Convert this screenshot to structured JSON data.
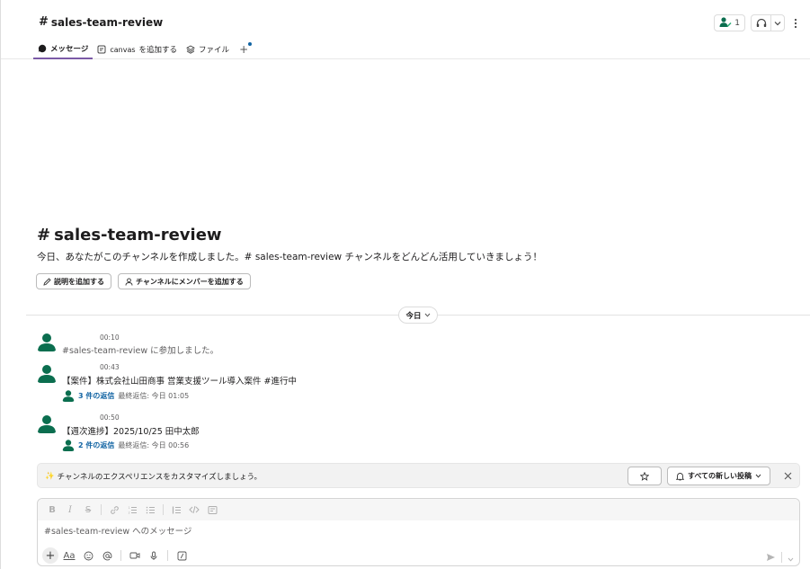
{
  "header": {
    "hash": "#",
    "channel_name": "sales-team-review",
    "member_count": "1",
    "tabs": [
      {
        "label": "メッセージ"
      },
      {
        "label": "を追加する",
        "prefix": "canvas"
      },
      {
        "label": "ファイル"
      }
    ],
    "add_tab_symbol": "+"
  },
  "intro": {
    "hash": "#",
    "title": "sales-team-review",
    "text": "今日、あなたがこのチャンネルを作成しました。# sales-team-review チャンネルをどんどん活用していきましょう！",
    "add_description_label": "説明を追加する",
    "add_member_label": "チャンネルにメンバーを追加する"
  },
  "divider": {
    "label": "今日"
  },
  "messages": [
    {
      "time": "00:10",
      "text": "#sales-team-review に参加しました。"
    },
    {
      "time": "00:43",
      "text": "【案件】株式会社山田商事 営業支援ツール導入案件 #進行中",
      "reply_count": "3 件の返信",
      "last_reply": "最終返信: 今日 01:05"
    },
    {
      "time": "00:50",
      "text": "【週次進捗】2025/10/25 田中太郎",
      "reply_count": "2 件の返信",
      "last_reply": "最終返信: 今日 00:56"
    }
  ],
  "banner": {
    "sparkle": "✨",
    "text": "チャンネルのエクスペリエンスをカスタマイズしましょう。",
    "notify_label": "すべての新しい投稿"
  },
  "composer": {
    "placeholder": "#sales-team-review へのメッセージ",
    "format_label": "Aa"
  },
  "colors": {
    "accent_tab": "#7b5aa6",
    "avatar": "#0b6e4f",
    "link": "#1264a3"
  }
}
